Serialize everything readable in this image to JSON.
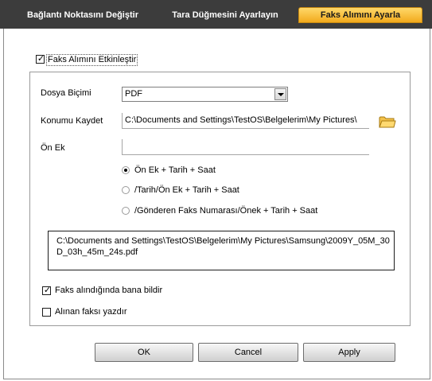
{
  "tabs": {
    "tab1": "Bağlantı Noktasını Değiştir",
    "tab2": "Tara Düğmesini Ayarlayın",
    "tab3": "Faks Alımını Ayarla"
  },
  "enable": {
    "label": "Faks Alımını Etkinleştir",
    "checked": true
  },
  "file_format": {
    "label": "Dosya Biçimi",
    "value": "PDF"
  },
  "save_location": {
    "label": "Konumu Kaydet",
    "value": "C:\\Documents and Settings\\TestOS\\Belgelerim\\My Pictures\\"
  },
  "prefix": {
    "label": "Ön Ek",
    "value": ""
  },
  "radio_options": [
    {
      "label": "Ön Ek + Tarih + Saat",
      "selected": true
    },
    {
      "label": "/Tarih/Ön Ek + Tarih + Saat",
      "selected": false
    },
    {
      "label": "/Gönderen Faks Numarası/Önek + Tarih + Saat",
      "selected": false
    }
  ],
  "preview_path": "C:\\Documents and Settings\\TestOS\\Belgelerim\\My Pictures\\Samsung\\2009Y_05M_30D_03h_45m_24s.pdf",
  "notify": {
    "label": "Faks alındığında bana bildir",
    "checked": true
  },
  "print_received": {
    "label": "Alınan faksı yazdır",
    "checked": false
  },
  "buttons": {
    "ok": "OK",
    "cancel": "Cancel",
    "apply": "Apply"
  },
  "colors": {
    "tab_bar": "#3c3c3c",
    "active_tab": "#f7c948"
  }
}
